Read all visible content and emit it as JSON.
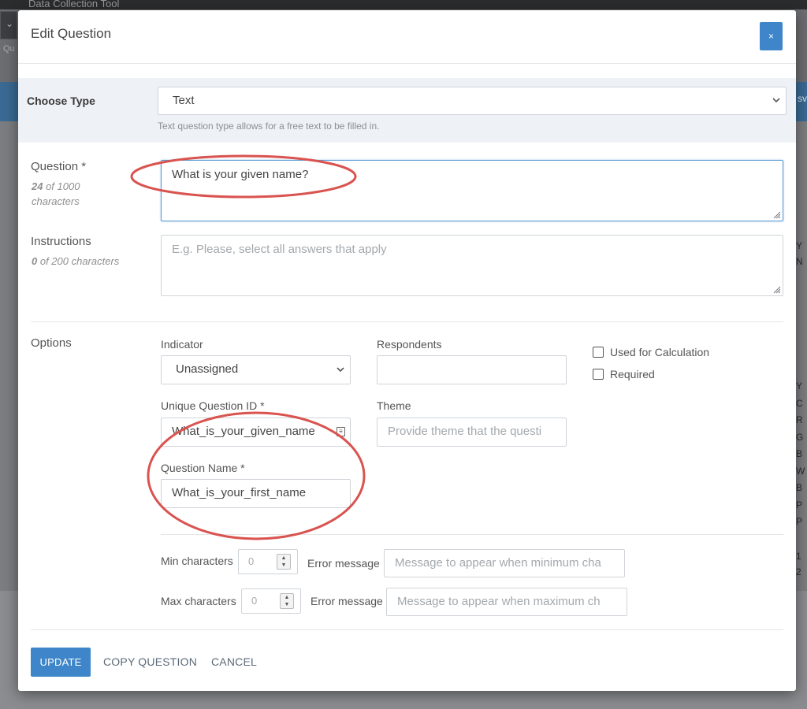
{
  "background": {
    "app_title": "Data Collection Tool",
    "dropdown_glyph": "⌄",
    "tab_text": "Qu",
    "right_column_letters": [
      "Y",
      "N",
      "Y",
      "C",
      "R",
      "G",
      "B",
      "W",
      "B",
      "P",
      "P",
      "1",
      "2"
    ],
    "right_tab_text": "sv"
  },
  "modal": {
    "title": "Edit Question",
    "close_label": "×",
    "choose_type": {
      "label": "Choose Type",
      "selected": "Text",
      "hint": "Text question type allows for a free text to be filled in."
    },
    "question": {
      "label": "Question *",
      "count": "24",
      "count_suffix": " of 1000",
      "count_line2": "characters",
      "value": "What is your given name?"
    },
    "instructions": {
      "label": "Instructions",
      "count": "0",
      "count_suffix": " of 200 characters",
      "placeholder": "E.g. Please, select all answers that apply"
    },
    "options": {
      "label": "Options",
      "indicator": {
        "label": "Indicator",
        "selected": "Unassigned"
      },
      "respondents": {
        "label": "Respondents",
        "value": ""
      },
      "used_for_calculation": {
        "label": "Used for Calculation",
        "checked": false
      },
      "required": {
        "label": "Required",
        "checked": false
      },
      "unique_id": {
        "label": "Unique Question ID *",
        "value": "What_is_your_given_name"
      },
      "theme": {
        "label": "Theme",
        "placeholder": "Provide theme that the questi"
      },
      "question_name": {
        "label": "Question Name *",
        "value": "What_is_your_first_name"
      },
      "min_characters": {
        "label": "Min characters",
        "value": "0",
        "error_label": "Error message",
        "error_placeholder": "Message to appear when minimum cha"
      },
      "max_characters": {
        "label": "Max characters",
        "value": "0",
        "error_label": "Error message",
        "error_placeholder": "Message to appear when maximum ch"
      }
    },
    "footer": {
      "update": "UPDATE",
      "copy": "COPY QUESTION",
      "cancel": "CANCEL"
    }
  },
  "colors": {
    "accent": "#3e86c9",
    "annotation": "#d9534f",
    "overlay": "#6b6d70"
  },
  "icons": {
    "close": "close-icon",
    "dropdown": "chevron-down-icon",
    "calendar": "calendar-icon",
    "spinner": "stepper-arrows-icon",
    "resize": "resize-grip-icon"
  }
}
